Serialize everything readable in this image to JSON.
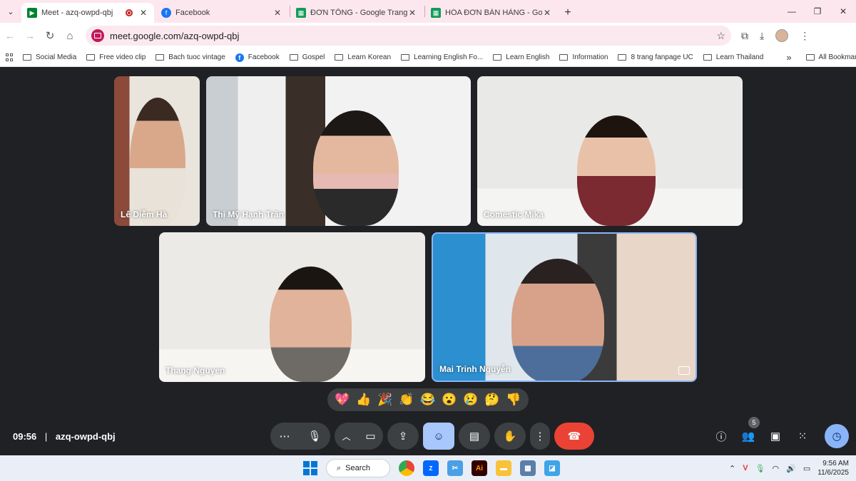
{
  "browser": {
    "tabs": [
      {
        "title": "Meet - azq-owpd-qbj",
        "active": true,
        "icon": "google-meet-icon",
        "recording": true
      },
      {
        "title": "Facebook",
        "active": false,
        "icon": "facebook-icon"
      },
      {
        "title": "ĐƠN TỔNG - Google Trang tính",
        "active": false,
        "icon": "google-sheets-icon"
      },
      {
        "title": "HÓA ĐƠN BÁN HÀNG - Google",
        "active": false,
        "icon": "google-sheets-icon"
      }
    ],
    "url": "meet.google.com/azq-owpd-qbj",
    "bookmarks": [
      "Social Media",
      "Free video clip",
      "Bach tuoc vintage",
      "Facebook",
      "Gospel",
      "Learn Korean",
      "Learning English Fo...",
      "Learn English",
      "Information",
      "8 trang fanpage UC",
      "Learn Thailand"
    ],
    "bookmarks_overflow": "»",
    "all_bookmarks": "All Bookmarks"
  },
  "meet": {
    "participants": [
      {
        "name": "Lê Diễm Hà"
      },
      {
        "name": "Thị Mỹ Hạnh Trần"
      },
      {
        "name": "Comestic Mika"
      },
      {
        "name": "Thang Nguyen"
      },
      {
        "name": "Mai Trinh Nguyễn"
      }
    ],
    "reactions": [
      "💖",
      "👍",
      "🎉",
      "👏",
      "😂",
      "😮",
      "😢",
      "🤔",
      "👎"
    ],
    "time": "09:56",
    "meeting_code": "azq-owpd-qbj",
    "people_count": "5"
  },
  "taskbar": {
    "search_label": "Search",
    "time": "9:56 AM",
    "date": "11/6/2025"
  },
  "colors": {
    "meet_background": "#202124",
    "end_call": "#ea4335",
    "active_control": "#a8c7fa",
    "tab_strip": "#fde7ef"
  }
}
